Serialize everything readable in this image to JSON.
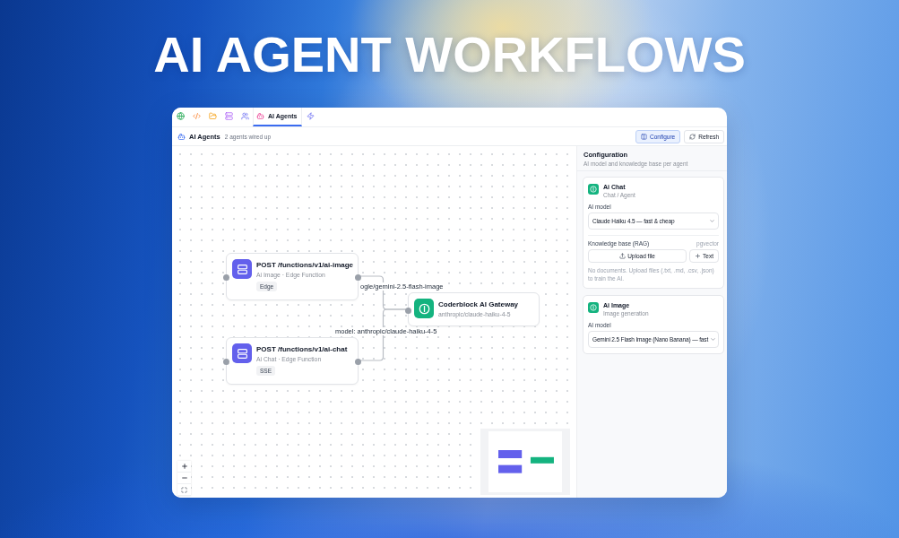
{
  "headline": "AI AGENT WORKFLOWS",
  "tabs": [
    {
      "kind": "globe",
      "selected": false
    },
    {
      "kind": "code",
      "selected": false
    },
    {
      "kind": "folder",
      "selected": false
    },
    {
      "kind": "server",
      "selected": false
    },
    {
      "kind": "users",
      "selected": false
    },
    {
      "kind": "bot",
      "label": "AI Agents",
      "selected": true
    },
    {
      "kind": "zap",
      "selected": false
    }
  ],
  "header": {
    "title": "AI Agents",
    "subtitle": "2 agents wired up",
    "buttons": [
      {
        "kind": "configure",
        "label": "Configure",
        "selected": true
      },
      {
        "kind": "refresh",
        "label": "Refresh",
        "selected": false
      }
    ]
  },
  "canvas": {
    "nodes": [
      {
        "kind": "endpoint",
        "title": "POST /functions/v1/ai-image",
        "subtitle": "Ai Image · Edge Function",
        "badge": "Edge"
      },
      {
        "kind": "endpoint",
        "title": "POST /functions/v1/ai-chat",
        "subtitle": "Ai Chat · Edge Function",
        "badge": "SSE"
      },
      {
        "kind": "gateway",
        "title": "Coderblock AI Gateway",
        "subtitle": "anthropic/claude-haiku-4-5"
      }
    ],
    "edges": [
      {
        "label": "ogle/gemini-2.5-flash-image"
      },
      {
        "label": "model: anthropic/claude-haiku-4-5"
      }
    ]
  },
  "config": {
    "title": "Configuration",
    "subtitle": "AI model and knowledge base per agent",
    "agents": [
      {
        "name": "Ai Chat",
        "type": "Chat / Agent",
        "model_label": "AI model",
        "model": "Claude Haiku 4.5 — fast & cheap",
        "knowledge": {
          "label": "Knowledge base (RAG)",
          "engine": "pgvector",
          "upload": "Upload file",
          "add_text": "Text",
          "note": "No documents. Upload files (.txt, .md, .csv, .json) to train the AI."
        }
      },
      {
        "name": "Ai Image",
        "type": "Image generation",
        "model_label": "AI model",
        "model": "Gemini 2.5 Flash Image (Nano Banana) — fast"
      }
    ]
  }
}
